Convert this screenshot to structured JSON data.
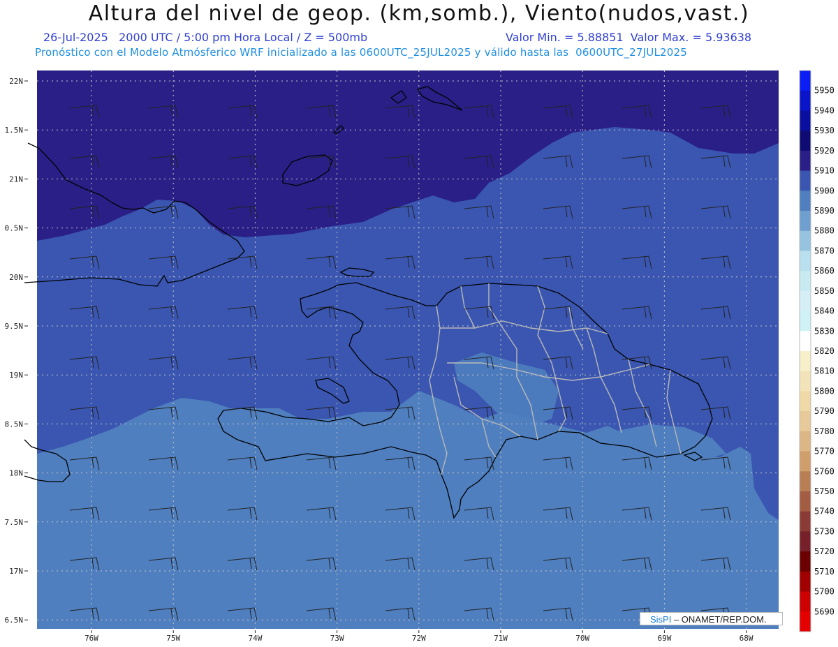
{
  "header": {
    "title": "Altura del nivel de geop. (km,somb.), Viento(nudos,vast.)",
    "info_left": "26-Jul-2025   2000 UTC / 5:00 pm Hora Local / Z = 500mb",
    "info_right": "Valor Min. = 5.88851  Valor Max. = 5.93638",
    "subtitle": "Pronóstico con el Modelo Atmósferico WRF inicializado a las 0600UTC_25JUL2025 y válido hasta las  0600UTC_27JUL2025"
  },
  "axes": {
    "lat_labels": [
      "22N",
      "1.5N",
      "21N",
      "0.5N",
      "20N",
      "9.5N",
      "19N",
      "8.5N",
      "18N",
      "7.5N",
      "17N",
      "6.5N"
    ],
    "lon_labels": [
      "76W",
      "75W",
      "74W",
      "73W",
      "72W",
      "71W",
      "70W",
      "69W",
      "68W"
    ]
  },
  "colorbar": {
    "levels": [
      "5950",
      "5940",
      "5930",
      "5920",
      "5910",
      "5900",
      "5890",
      "5880",
      "5870",
      "5860",
      "5850",
      "5840",
      "5830",
      "5820",
      "5810",
      "5800",
      "5790",
      "5780",
      "5770",
      "5760",
      "5750",
      "5740",
      "5730",
      "5720",
      "5710",
      "5700",
      "5690"
    ],
    "colors": [
      "#0a1df2",
      "#0a14c8",
      "#0b0fa0",
      "#0e0c72",
      "#2a1f86",
      "#3a56b0",
      "#4f7fbf",
      "#6e9fce",
      "#96c3e0",
      "#b8e0ee",
      "#c8ebf2",
      "#d6eff6",
      "#cff2f6",
      "#ffffff",
      "#f7efc9",
      "#f2e4b8",
      "#efd9a7",
      "#e7c99a",
      "#dcb684",
      "#cf9e6b",
      "#ba7e54",
      "#a35d43",
      "#8a3b35",
      "#76202a",
      "#6b0000",
      "#a00000",
      "#cc0000",
      "#e40000"
    ]
  },
  "field": {
    "north_color": "#2a1f86",
    "middle_color": "#3a56b0",
    "south_color": "#4f7fbf",
    "light_patch_color": "#6e9fce"
  },
  "credit": {
    "brand": "SisPI",
    "org": " – ONAMET/REP.DOM."
  }
}
